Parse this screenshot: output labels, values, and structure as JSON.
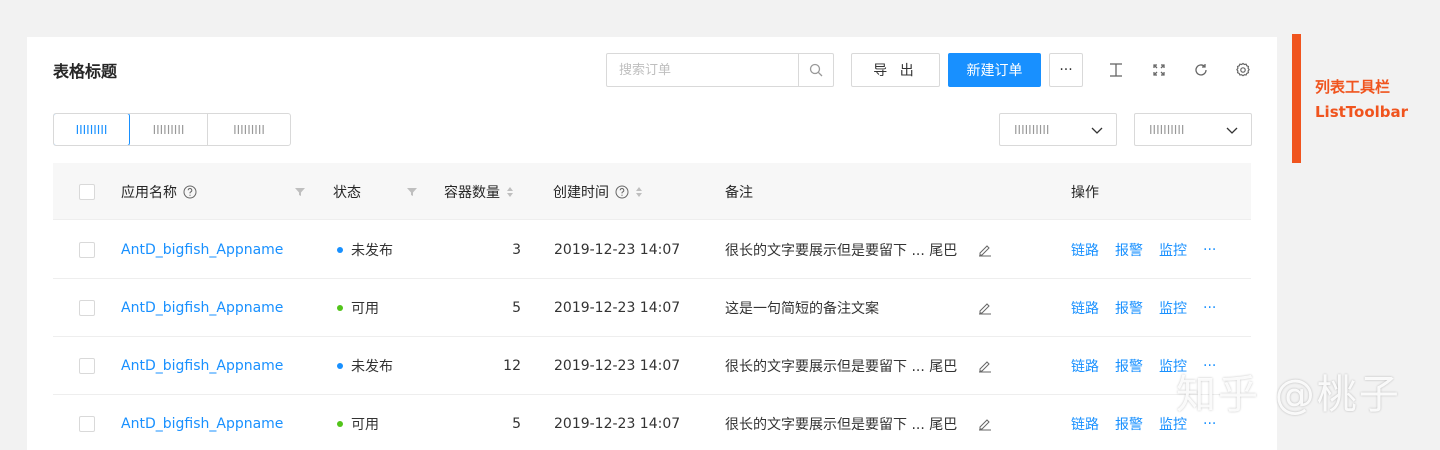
{
  "table_title": "表格标题",
  "search": {
    "placeholder": "搜索订单",
    "value": ""
  },
  "buttons": {
    "export": "导 出",
    "new_order": "新建订单",
    "more": "···"
  },
  "view_segments": [
    "IIIIIIIII",
    "IIIIIIIII",
    "IIIIIIIII"
  ],
  "filters": [
    {
      "value": "IIIIIIIIII"
    },
    {
      "value": "IIIIIIIIII"
    }
  ],
  "columns": {
    "select": "",
    "app_name": "应用名称",
    "status": "状态",
    "containers": "容器数量",
    "created": "创建时间",
    "note": "备注",
    "actions": "操作"
  },
  "rows": [
    {
      "app": "AntD_bigfish_Appname",
      "status": "未发布",
      "status_color": "#1890ff",
      "count": "3",
      "created": "2019-12-23 14:07",
      "note": "很长的文字要展示但是要留下 ... 尾巴"
    },
    {
      "app": "AntD_bigfish_Appname",
      "status": "可用",
      "status_color": "#52c41a",
      "count": "5",
      "created": "2019-12-23 14:07",
      "note": "这是一句简短的备注文案"
    },
    {
      "app": "AntD_bigfish_Appname",
      "status": "未发布",
      "status_color": "#1890ff",
      "count": "12",
      "created": "2019-12-23 14:07",
      "note": "很长的文字要展示但是要留下 ... 尾巴"
    },
    {
      "app": "AntD_bigfish_Appname",
      "status": "可用",
      "status_color": "#52c41a",
      "count": "5",
      "created": "2019-12-23 14:07",
      "note": "很长的文字要展示但是要留下 ... 尾巴"
    }
  ],
  "row_actions": {
    "link": "链路",
    "alarm": "报警",
    "monitor": "监控",
    "more": "···"
  },
  "annotation": {
    "line1": "列表工具栏",
    "line2": "ListToolbar"
  },
  "watermark": "知乎 @桃子",
  "colors": {
    "primary": "#1890ff",
    "success": "#52c41a",
    "annotation": "#f0541e"
  }
}
